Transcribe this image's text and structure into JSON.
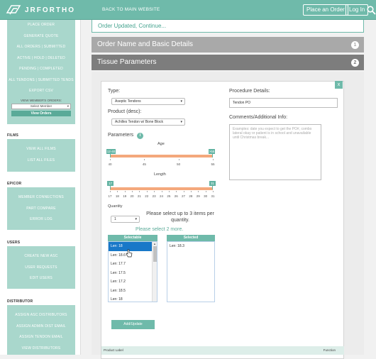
{
  "header": {
    "logo_text": "JRFORTHO",
    "back_link": "BACK TO MAIN WEBSITE",
    "place_order": "Place an Order",
    "login": "Log In"
  },
  "sidebar": {
    "group1": [
      "PLACE ORDER",
      "GENERATE QUOTE",
      "ALL ORDERS | SUBMITTED",
      "ACTIVE | HOLD | DELETED",
      "PENDING | COMPLETED",
      "ALL TENDONS | SUBMITTED TENDS",
      "EXPORT CSV"
    ],
    "view_members_label": "VIEW MEMBER'S ORDERS:",
    "select_member": "Select Member",
    "view_orders": "View Orders",
    "films_head": "FILMS",
    "films": [
      "VIEW ALL FILMS",
      "LIST ALL FILES"
    ],
    "epicor_head": "EPICOR",
    "epicor": [
      "MEMBER CONNECTIONS",
      "PART COMPARE",
      "ERROR LOG"
    ],
    "users_head": "USERS",
    "users": [
      "CREATE NEW ASC",
      "USER REQUESTS",
      "EDIT USERS"
    ],
    "distributor_head": "DISTRIBUTOR",
    "distributor": [
      "ASSIGN ASC DISTRIBUTORS",
      "ASSIGN ADMIN DIST EMAIL",
      "ASSIGN TENDON EMAIL",
      "VIEW DISTRIBUTORS"
    ]
  },
  "main": {
    "message": "Order Updated, Continue...",
    "acc1": {
      "title": "Order Name and Basic Details",
      "num": "1"
    },
    "acc2": {
      "title": "Tissue Parameters",
      "num": "2"
    }
  },
  "form": {
    "close": "x",
    "type_label": "Type:",
    "type_value": "Aseptic Tendons",
    "product_label": "Product (desc):",
    "product_value": "Achilles Tendon w/ Bone Block",
    "parameters_label": "Parameters",
    "info_icon": "i",
    "age_label": "Age",
    "age_min_handle": "12-40",
    "age_max_handle": ">55",
    "age_ticks": [
      "40",
      "45",
      "50",
      "55"
    ],
    "length_label": "Length",
    "len_min_handle": "17",
    "len_max_handle": "31",
    "len_ticks": [
      "17",
      "18",
      "19",
      "20",
      "21",
      "22",
      "23",
      "24",
      "25",
      "26",
      "27",
      "28",
      "29",
      "30",
      "31"
    ],
    "quantity_label": "Quantity",
    "quantity_value": "1",
    "select_hint": "Please select up to 3 items per quantity.",
    "select_more": "Please select 2 more.",
    "selectable_head": "Selectable",
    "selected_head": "Selected",
    "selectable_items": [
      "Len: 18",
      "Len: 18.6",
      "Len: 17.7",
      "Len: 17.5",
      "Len: 17.2",
      "Len: 18.5",
      "Len: 18"
    ],
    "selected_items": [
      "Len: 18.3"
    ],
    "add_update": "Add/Update",
    "procedure_label": "Procedure Details:",
    "procedure_value": "Tendon PO",
    "comments_label": "Comments/Additional Info:",
    "comments_placeholder": "Examples: date you expect to get the PO#, combo lateral okay or patient is in school and unavailable until Christmas break...",
    "footer_product": "Product Label",
    "footer_function": "Function"
  },
  "colors": {
    "accent": "#6fbaaa",
    "slider": "#f4a87c",
    "accordion": "#a9a9a9",
    "accordion_active": "#7d7d7d"
  }
}
